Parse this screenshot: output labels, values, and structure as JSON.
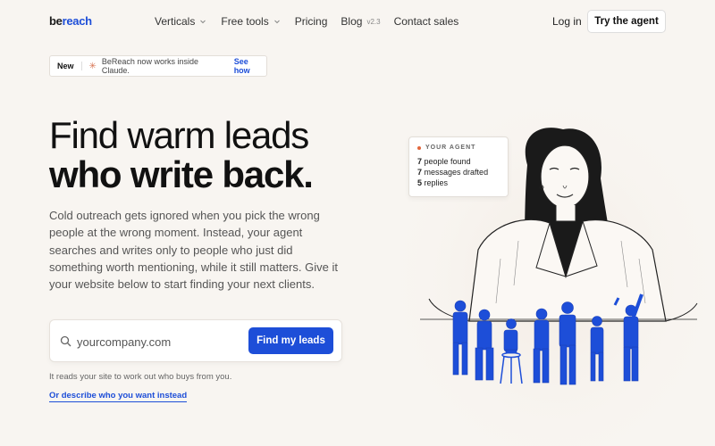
{
  "logo": {
    "part1": "be",
    "part2": "reach"
  },
  "nav": {
    "items": [
      {
        "label": "Verticals",
        "has_dropdown": true
      },
      {
        "label": "Free tools",
        "has_dropdown": true
      },
      {
        "label": "Pricing",
        "has_dropdown": false
      },
      {
        "label": "Blog",
        "has_dropdown": false,
        "version": "v2.3"
      },
      {
        "label": "Contact sales",
        "has_dropdown": false
      }
    ],
    "login": "Log in",
    "cta": "Try the agent"
  },
  "badge": {
    "tag": "New",
    "icon": "sparkle-icon",
    "text": "BeReach now works inside Claude.",
    "link": "See how"
  },
  "hero": {
    "title_line1": "Find warm leads",
    "title_line2": "who write back.",
    "description": "Cold outreach gets ignored when you pick the wrong people at the wrong moment. Instead, your agent searches and writes only to people who just did something worth mentioning, while it still matters. Give it your website below to start finding your next clients."
  },
  "search": {
    "placeholder": "yourcompany.com",
    "button": "Find my leads"
  },
  "hint": "It reads your site to work out who buys from you.",
  "alt_link": "Or describe who you want instead",
  "agent_card": {
    "title": "YOUR AGENT",
    "stats": [
      {
        "count": "7",
        "label": "people found"
      },
      {
        "count": "7",
        "label": "messages drafted"
      },
      {
        "count": "5",
        "label": "replies"
      }
    ]
  },
  "colors": {
    "accent": "#1d4ed8",
    "background": "#f8f5f1",
    "dot": "#e2663b"
  }
}
